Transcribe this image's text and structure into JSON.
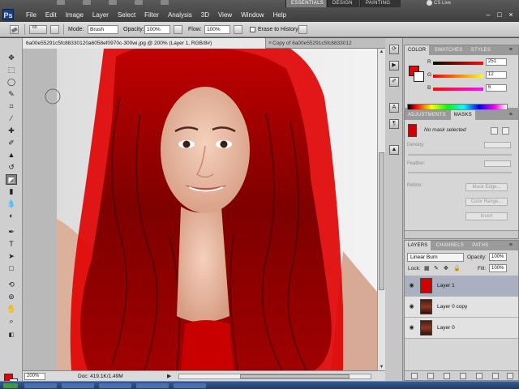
{
  "app": {
    "logo": "Ps",
    "menu": [
      "File",
      "Edit",
      "Image",
      "Layer",
      "Select",
      "Filter",
      "Analysis",
      "3D",
      "View",
      "Window",
      "Help"
    ],
    "workspaces": [
      "ESSENTIALS",
      "DESIGN",
      "PAINTING"
    ],
    "cslive": "CS Live",
    "window_controls": [
      "–",
      "□",
      "×"
    ]
  },
  "options_bar": {
    "brush_size": "60",
    "mode_label": "Mode:",
    "mode_value": "Brush",
    "opacity_label": "Opacity:",
    "opacity_value": "100%",
    "flow_label": "Flow:",
    "flow_value": "100%",
    "erase_history": "Erase to History"
  },
  "document": {
    "tab_title": "6a00e55291c5fc88330120a6058ef0970c-300wi.jpg @ 200% (Layer 1, RGB/8#)",
    "tab_close": "×",
    "tab_title_2": "Copy of 6a00e55291c5fc8833012",
    "zoom": "200%",
    "doc_size": "Doc: 419.1K/1.49M"
  },
  "tools": {
    "icons": [
      "move-icon",
      "marquee-icon",
      "lasso-icon",
      "quick-select-icon",
      "crop-icon",
      "eyedropper-icon",
      "healing-icon",
      "brush-icon",
      "clone-stamp-icon",
      "history-brush-icon",
      "eraser-icon",
      "gradient-icon",
      "blur-icon",
      "dodge-icon",
      "pen-icon",
      "type-icon",
      "path-select-icon",
      "shape-icon",
      "3d-rotate-icon",
      "3d-orbit-icon",
      "hand-icon",
      "zoom-icon"
    ],
    "selected_index": 10,
    "foreground_color": "#e00000",
    "background_color": "#ffffff"
  },
  "color_panel": {
    "tabs": [
      "COLOR",
      "SWATCHES",
      "STYLES"
    ],
    "channels": [
      {
        "label": "R",
        "value": "251"
      },
      {
        "label": "G",
        "value": "12"
      },
      {
        "label": "B",
        "value": "6"
      }
    ]
  },
  "masks_panel": {
    "tabs": [
      "ADJUSTMENTS",
      "MASKS"
    ],
    "status": "No mask selected",
    "rows": [
      "Density:",
      "Feather:",
      "Refine:"
    ],
    "buttons": [
      "Mask Edge...",
      "Color Range...",
      "Invert"
    ]
  },
  "layers_panel": {
    "tabs": [
      "LAYERS",
      "CHANNELS",
      "PATHS"
    ],
    "blend_mode": "Linear Burn",
    "opacity_label": "Opacity:",
    "opacity_value": "100%",
    "lock_label": "Lock:",
    "fill_label": "Fill:",
    "fill_value": "100%",
    "layers": [
      {
        "name": "Layer 1",
        "selected": true,
        "color": "#d30000"
      },
      {
        "name": "Layer 0 copy",
        "selected": false,
        "color": "#6b2a1c"
      },
      {
        "name": "Layer 0",
        "selected": false,
        "color": "#6b2a1c"
      }
    ]
  }
}
